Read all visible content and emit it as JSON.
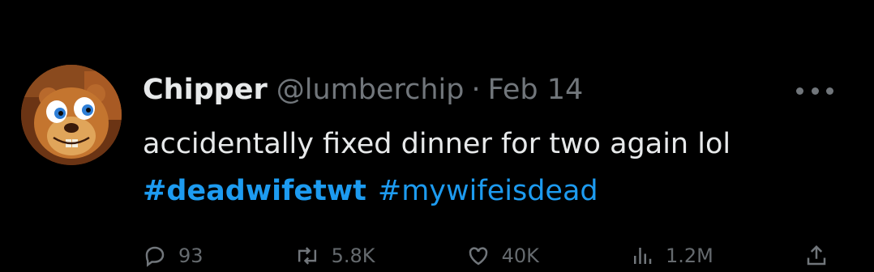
{
  "tweet": {
    "display_name": "Chipper",
    "handle": "@lumberchip",
    "separator": "·",
    "date": "Feb 14",
    "text": "accidentally fixed dinner for two again lol",
    "hashtags": [
      "#deadwifetwt",
      "#mywifeisdead"
    ],
    "more_icon": "more-horizontal-icon",
    "avatar_icon": "cartoon-beaver-avatar"
  },
  "actions": [
    {
      "icon": "reply-icon",
      "count": "93"
    },
    {
      "icon": "retweet-icon",
      "count": "5.8K"
    },
    {
      "icon": "like-icon",
      "count": "40K"
    },
    {
      "icon": "views-icon",
      "count": "1.2M"
    },
    {
      "icon": "share-icon",
      "count": ""
    }
  ],
  "colors": {
    "background": "#000000",
    "text": "#e7e9ea",
    "muted": "#71767b",
    "link": "#1d9bf0"
  }
}
